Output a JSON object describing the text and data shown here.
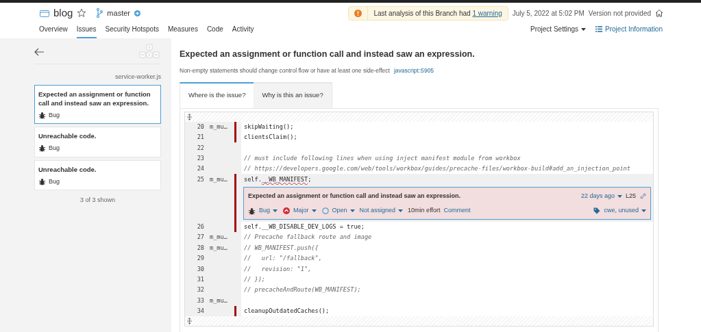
{
  "project": {
    "name": "blog",
    "starred": false,
    "branch": "master"
  },
  "nav": [
    {
      "label": "Overview",
      "selected": false
    },
    {
      "label": "Issues",
      "selected": true
    },
    {
      "label": "Security Hotspots",
      "selected": false
    },
    {
      "label": "Measures",
      "selected": false
    },
    {
      "label": "Code",
      "selected": false
    },
    {
      "label": "Activity",
      "selected": false
    }
  ],
  "warning": {
    "text": "Last analysis of this Branch had ",
    "link": "1 warning"
  },
  "analysis_date": "July 5, 2022 at 5:02 PM",
  "version": "Version not provided",
  "project_settings": "Project Settings",
  "project_information": "Project Information",
  "sidebar": {
    "file": "service-worker.js",
    "issues": [
      {
        "title": "Expected an assignment or function call and instead saw an expression.",
        "type": "Bug",
        "selected": true
      },
      {
        "title": "Unreachable code.",
        "type": "Bug",
        "selected": false
      },
      {
        "title": "Unreachable code.",
        "type": "Bug",
        "selected": false
      }
    ],
    "count": "3 of 3 shown"
  },
  "issue": {
    "title": "Expected an assignment or function call and instead saw an expression.",
    "description": "Non-empty statements should change control flow or have at least one side-effect",
    "rule": "javascript:S905"
  },
  "tabs": [
    {
      "label": "Where is the issue?",
      "selected": true
    },
    {
      "label": "Why is this an issue?",
      "selected": false
    }
  ],
  "lines": [
    {
      "number": "20",
      "author": "m_mu…",
      "marker": true,
      "kind": "code",
      "code": "skipWaiting();",
      "selected": false
    },
    {
      "number": "21",
      "marker": true,
      "kind": "code",
      "code": "clientsClaim();",
      "selected": false
    },
    {
      "number": "22",
      "marker": false,
      "kind": "blank",
      "selected": false
    },
    {
      "number": "23",
      "marker": false,
      "kind": "comment",
      "code": "// must include following lines when using inject manifest module from workbox",
      "selected": false
    },
    {
      "number": "24",
      "marker": false,
      "kind": "comment",
      "code": "// https://developers.google.com/web/tools/workbox/guides/precache-files/workbox-build#add_an_injection_point",
      "selected": false
    },
    {
      "number": "25",
      "author": "m_mu…",
      "marker": true,
      "kind": "code",
      "code": "self.",
      "flagged_code": "__WB_MANIFEST",
      "code_suffix": ";",
      "selected": true,
      "issue": {
        "message": "Expected an assignment or function call and instead saw an expression.",
        "type": "Bug",
        "severity": "Major",
        "status": "Open",
        "assignee": "Not assigned",
        "effort": "10min effort",
        "comment": "Comment",
        "age": "22 days ago",
        "line": "L25",
        "tags": "cwe, unused"
      }
    },
    {
      "number": "26",
      "marker": true,
      "kind": "code",
      "code": "self.__WB_DISABLE_DEV_LOGS = true;",
      "selected": false
    },
    {
      "number": "27",
      "author": "m_mu…",
      "marker": false,
      "kind": "comment",
      "code": "// Precache fallback route and image",
      "selected": false
    },
    {
      "number": "28",
      "author": "m_mu…",
      "marker": false,
      "kind": "comment",
      "code": "// WB_MANIFEST.push({",
      "selected": false
    },
    {
      "number": "29",
      "marker": false,
      "kind": "comment",
      "code": "//   url: \"/fallback\",",
      "selected": false
    },
    {
      "number": "30",
      "marker": false,
      "kind": "comment",
      "code": "//   revision: \"1\",",
      "selected": false
    },
    {
      "number": "31",
      "marker": false,
      "kind": "comment",
      "code": "// });",
      "selected": false
    },
    {
      "number": "32",
      "marker": false,
      "kind": "comment",
      "code": "// precacheAndRoute(WB_MANIFEST);",
      "selected": false
    },
    {
      "number": "33",
      "author": "m_mu…",
      "marker": false,
      "kind": "blank",
      "selected": false
    },
    {
      "number": "34",
      "marker": true,
      "kind": "code",
      "code": "cleanupOutdatedCaches();",
      "selected": false
    }
  ]
}
